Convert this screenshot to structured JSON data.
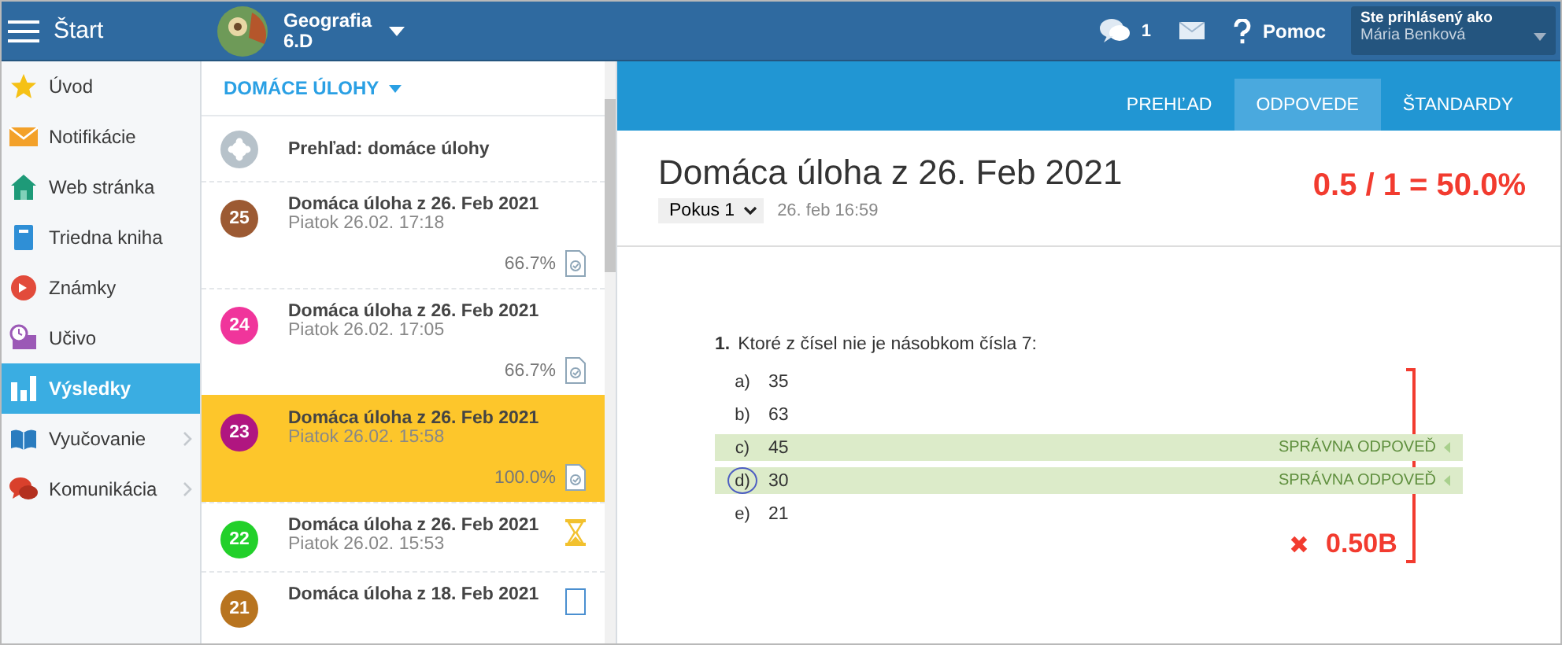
{
  "topbar": {
    "menu_label": "Štart",
    "course": {
      "name": "Geografia",
      "class": "6.D"
    },
    "messages_count": "1",
    "help": "Pomoc",
    "user": {
      "label": "Ste prihlásený ako",
      "name": "Mária Benková"
    }
  },
  "sidebar": {
    "items": [
      {
        "label": "Úvod",
        "selected": false,
        "expandable": false
      },
      {
        "label": "Notifikácie",
        "selected": false,
        "expandable": false
      },
      {
        "label": "Web stránka",
        "selected": false,
        "expandable": false
      },
      {
        "label": "Triedna kniha",
        "selected": false,
        "expandable": false
      },
      {
        "label": "Známky",
        "selected": false,
        "expandable": false
      },
      {
        "label": "Učivo",
        "selected": false,
        "expandable": false
      },
      {
        "label": "Výsledky",
        "selected": true,
        "expandable": false
      },
      {
        "label": "Vyučovanie",
        "selected": false,
        "expandable": true
      },
      {
        "label": "Komunikácia",
        "selected": false,
        "expandable": true
      }
    ]
  },
  "task_list": {
    "header": "DOMÁCE ÚLOHY",
    "overview": "Prehľad: domáce úlohy",
    "items": [
      {
        "number": "25",
        "color": "#9c5a33",
        "title": "Domáca úloha z 26. Feb 2021",
        "subtitle": "Piatok 26.02. 17:18",
        "score": "66.7%",
        "kind": "graded",
        "selected": false
      },
      {
        "number": "24",
        "color": "#f0359b",
        "title": "Domáca úloha z 26. Feb 2021",
        "subtitle": "Piatok 26.02. 17:05",
        "score": "66.7%",
        "kind": "graded",
        "selected": false
      },
      {
        "number": "23",
        "color": "#b01680",
        "title": "Domáca úloha z 26. Feb 2021",
        "subtitle": "Piatok 26.02. 15:58",
        "score": "100.0%",
        "kind": "graded",
        "selected": true
      },
      {
        "number": "22",
        "color": "#22d02a",
        "title": "Domáca úloha z 26. Feb 2021",
        "subtitle": "Piatok 26.02. 15:53",
        "kind": "pending",
        "selected": false
      },
      {
        "number": "21",
        "color": "#b8741f",
        "title": "Domáca úloha z 18. Feb 2021",
        "kind": "question",
        "selected": false
      }
    ]
  },
  "detail": {
    "tabs": [
      {
        "label": "PREHĽAD",
        "selected": false
      },
      {
        "label": "ODPOVEDE",
        "selected": true
      },
      {
        "label": "ŠTANDARDY",
        "selected": false
      }
    ],
    "title": "Domáca úloha z 26. Feb 2021",
    "attempt": "Pokus 1",
    "date": "26. feb 16:59",
    "score": "0.5 / 1 = 50.0%",
    "question": {
      "number": "1.",
      "text": "Ktoré z čísel nie je násobkom čísla 7:",
      "options": [
        {
          "letter": "a)",
          "value": "35",
          "correct": false,
          "chosen": false
        },
        {
          "letter": "b)",
          "value": "63",
          "correct": false,
          "chosen": false
        },
        {
          "letter": "c)",
          "value": "45",
          "correct": true,
          "chosen": false,
          "note": "SPRÁVNA ODPOVEĎ"
        },
        {
          "letter": "d)",
          "value": "30",
          "correct": true,
          "chosen": true,
          "note": "SPRÁVNA ODPOVEĎ"
        },
        {
          "letter": "e)",
          "value": "21",
          "correct": false,
          "chosen": false
        }
      ],
      "passed": false,
      "points": "0.50B"
    }
  }
}
